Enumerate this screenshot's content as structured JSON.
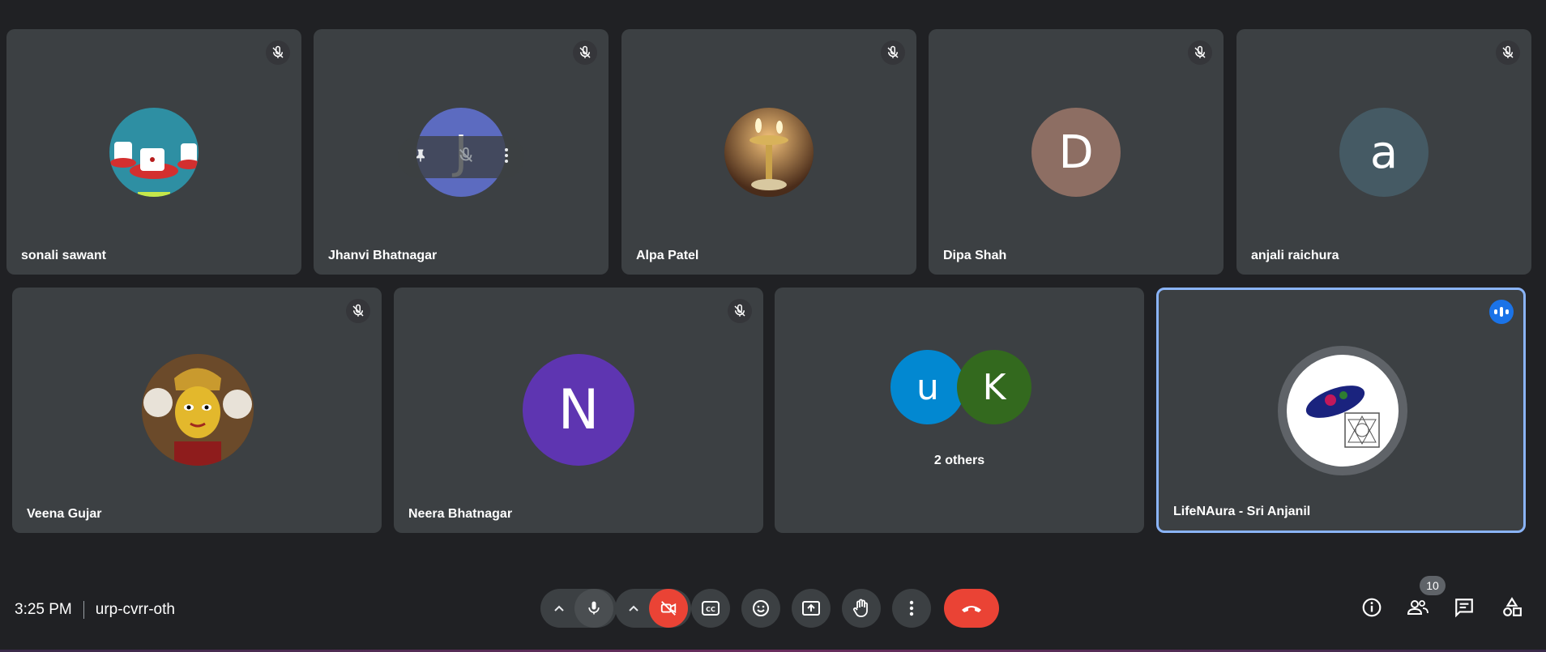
{
  "participants_row1": [
    {
      "name": "sonali sawant",
      "avatar": "image-cups",
      "muted": true
    },
    {
      "name": "Jhanvi Bhatnagar",
      "avatar_letter": "J",
      "avatar_color": "#5c6bc0",
      "muted": true
    },
    {
      "name": "Alpa Patel",
      "avatar": "image-lamp",
      "muted": true
    },
    {
      "name": "Dipa Shah",
      "avatar_letter": "D",
      "avatar_color": "#8d6e63",
      "muted": true
    },
    {
      "name": "anjali raichura",
      "avatar_letter": "a",
      "avatar_color": "#455a64",
      "muted": true
    }
  ],
  "participants_row2": [
    {
      "name": "Veena Gujar",
      "avatar": "image-deity",
      "muted": true
    },
    {
      "name": "Neera Bhatnagar",
      "avatar_letter": "N",
      "avatar_color": "#5e35b1",
      "muted": true
    },
    {
      "group_letters": [
        "u",
        "K"
      ],
      "group_colors": [
        "#0288d1",
        "#33691e"
      ],
      "label": "2 others"
    },
    {
      "name": "LifeNAura - Sri Anjanil",
      "avatar": "image-logo",
      "speaking": true
    }
  ],
  "meeting": {
    "time": "3:25 PM",
    "code": "urp-cvrr-oth"
  },
  "people_count": "10",
  "colors": {
    "background": "#202124",
    "tile": "#3c4043",
    "accent": "#8ab4f8",
    "hangup": "#ea4335"
  }
}
